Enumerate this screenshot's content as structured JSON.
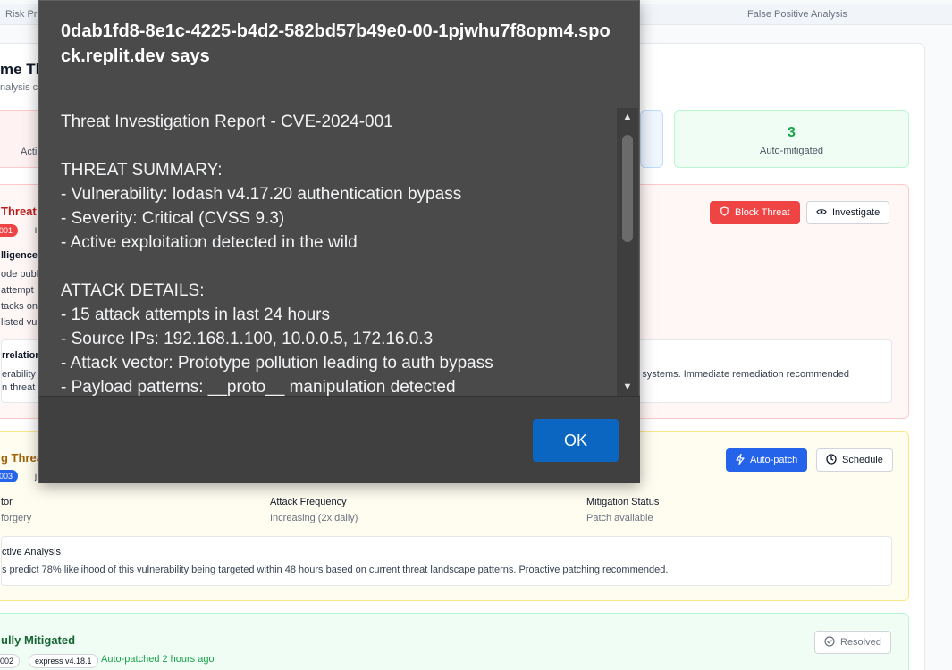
{
  "tabs": {
    "left": "Risk Pr",
    "right": "False Positive Analysis"
  },
  "page": {
    "title": "me Th",
    "subtitle": "nalysis c"
  },
  "stats": {
    "left_label": "Acti",
    "green_value": "3",
    "green_label": "Auto-mitigated"
  },
  "threat1": {
    "title": "Threat I",
    "badge": "001",
    "badge2": "l",
    "block_label": "Block Threat",
    "investigate_label": "Investigate",
    "intel_heading": "lligence",
    "intel_lines": [
      "ode publ",
      "attempt",
      "tacks on",
      "listed vu"
    ],
    "corr_heading": "rrelation",
    "corr_lines": [
      "erability",
      "n threat"
    ],
    "corr_right": "on systems. Immediate remediation recommended"
  },
  "threat2": {
    "title": "g Threa",
    "badge": "003",
    "badge2": "j",
    "autopatch_label": "Auto-patch",
    "schedule_label": "Schedule",
    "col1_label": "tor",
    "col1_value": "forgery",
    "col2_label": "Attack Frequency",
    "col2_value": "Increasing (2x daily)",
    "col3_label": "Mitigation Status",
    "col3_value": "Patch available",
    "pred_heading": "ctive Analysis",
    "pred_text": "s predict 78% likelihood of this vulnerability being targeted within 48 hours based on current threat landscape patterns. Proactive patching recommended."
  },
  "threat3": {
    "title": "ully Mitigated",
    "badge": "002",
    "package": "express v4.18.1",
    "status": "Auto-patched 2 hours ago",
    "resolved_label": "Resolved"
  },
  "dialog": {
    "title": "0dab1fd8-8e1c-4225-b4d2-582bd57b49e0-00-1pjwhu7f8opm4.spock.replit.dev says",
    "message": "Threat Investigation Report - CVE-2024-001\n\nTHREAT SUMMARY:\n- Vulnerability: lodash v4.17.20 authentication bypass\n- Severity: Critical (CVSS 9.3)\n- Active exploitation detected in the wild\n\nATTACK DETAILS:\n- 15 attack attempts in last 24 hours\n- Source IPs: 192.168.1.100, 10.0.0.5, 172.16.0.3\n- Attack vector: Prototype pollution leading to auth bypass\n- Payload patterns: __proto__ manipulation detected",
    "ok_label": "OK"
  },
  "colors": {
    "danger": "#ef4444",
    "primary": "#2563eb",
    "success": "#16a34a",
    "dialog_bg": "#4a4a4a",
    "ok_button": "#0b66c2"
  }
}
